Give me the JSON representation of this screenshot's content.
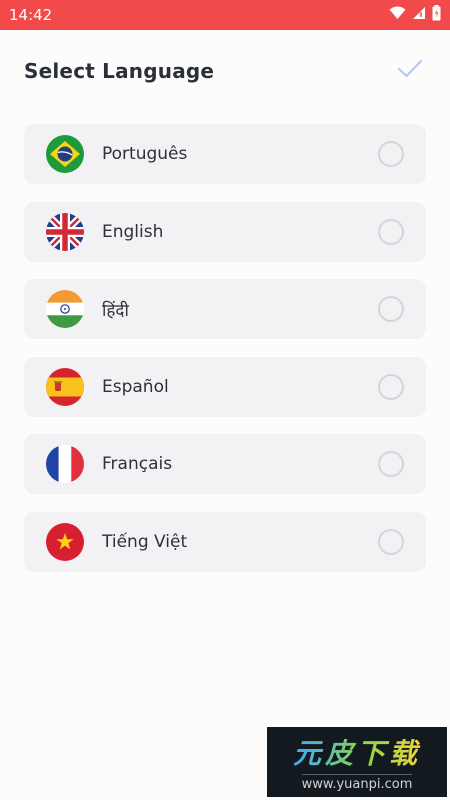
{
  "status_bar": {
    "time": "14:42",
    "icons": [
      "wifi-icon",
      "signal-icon",
      "battery-icon"
    ],
    "background": "#f24a4a"
  },
  "header": {
    "title": "Select Language",
    "confirm_icon": "checkmark-icon",
    "confirm_color": "#b9c8ee"
  },
  "languages": [
    {
      "label": "Português",
      "flag": "brazil-flag-icon",
      "selected": false
    },
    {
      "label": "English",
      "flag": "uk-flag-icon",
      "selected": false
    },
    {
      "label": "हिंदी",
      "flag": "india-flag-icon",
      "selected": false
    },
    {
      "label": "Español",
      "flag": "spain-flag-icon",
      "selected": false
    },
    {
      "label": "Français",
      "flag": "france-flag-icon",
      "selected": false
    },
    {
      "label": "Tiếng Việt",
      "flag": "vietnam-flag-icon",
      "selected": false
    }
  ],
  "watermark": {
    "title": "元皮下载",
    "url": "www.yuanpi.com"
  }
}
